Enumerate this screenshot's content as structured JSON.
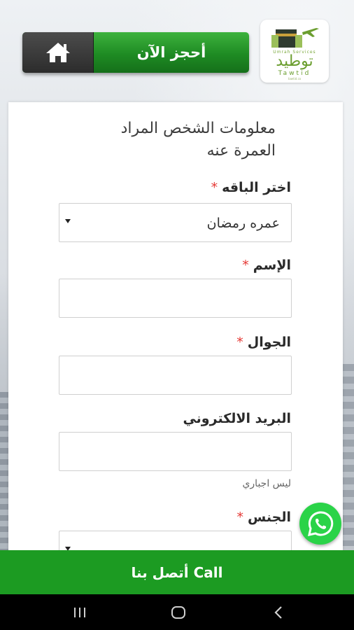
{
  "header": {
    "book_now_label": "أحجز الآن",
    "logo": {
      "arabic_name": "توطيد",
      "english_name": "Tawtid",
      "tagline": "Umrah Services",
      "sub_tagline": "tawtid.co"
    }
  },
  "form": {
    "title_line1": "معلومات الشخص المراد",
    "title_line2": "العمرة عنه",
    "required_mark": "*",
    "package": {
      "label": "اختر الباقه",
      "selected": "عمره رمضان"
    },
    "name": {
      "label": "الإسم",
      "value": ""
    },
    "mobile": {
      "label": "الجوال",
      "value": ""
    },
    "email": {
      "label": "البريد الالكتروني",
      "value": "",
      "hint": "ليس اجباري"
    },
    "gender": {
      "label": "الجنس"
    }
  },
  "call_bar": {
    "label": "أتصل بنا Call"
  },
  "icons": {
    "home": "home-icon",
    "whatsapp": "whatsapp-icon",
    "nav_recent": "recent-apps-icon",
    "nav_home": "nav-home-icon",
    "nav_back": "back-icon"
  },
  "colors": {
    "primary_green": "#1c9b22",
    "whatsapp_green": "#2ad348",
    "required_red": "#e53935",
    "home_button_dark": "#2c2c2c"
  }
}
